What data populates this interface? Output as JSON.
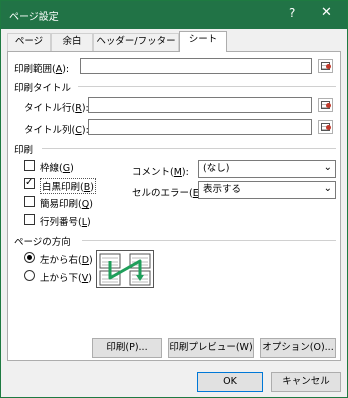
{
  "window": {
    "title": "ページ設定",
    "help_glyph": "?",
    "close_glyph": "✕"
  },
  "tabs": [
    {
      "label": "ページ",
      "active": false
    },
    {
      "label": "余白",
      "active": false
    },
    {
      "label": "ヘッダー/フッター",
      "active": false
    },
    {
      "label": "シート",
      "active": true
    }
  ],
  "print_area": {
    "label": "印刷範囲(",
    "accel": "A",
    "label_end": "):",
    "value": ""
  },
  "print_titles": {
    "heading": "印刷タイトル",
    "rows": {
      "label": "タイトル行(",
      "accel": "R",
      "label_end": "):",
      "value": ""
    },
    "cols": {
      "label": "タイトル列(",
      "accel": "C",
      "label_end": "):",
      "value": ""
    }
  },
  "print": {
    "heading": "印刷",
    "gridlines": {
      "label": "枠線(",
      "accel": "G",
      "label_end": ")",
      "checked": false
    },
    "blackwhite": {
      "label": "白黒印刷(",
      "accel": "B",
      "label_end": ")",
      "checked": true
    },
    "draft": {
      "label": "簡易印刷(",
      "accel": "Q",
      "label_end": ")",
      "checked": false
    },
    "headings": {
      "label": "行列番号(",
      "accel": "L",
      "label_end": ")",
      "checked": false
    },
    "comments": {
      "label": "コメント(",
      "accel": "M",
      "label_end": "):",
      "value": "(なし)"
    },
    "errors": {
      "label": "セルのエラー(",
      "accel": "E",
      "label_end": "):",
      "value": "表示する"
    }
  },
  "page_order": {
    "heading": "ページの方向",
    "down_then_over": {
      "label": "左から右(",
      "accel": "D",
      "label_end": ")",
      "selected": true
    },
    "over_then_down": {
      "label": "上から下(",
      "accel": "V",
      "label_end": ")",
      "selected": false
    }
  },
  "buttons": {
    "print": "印刷(P)...",
    "preview": "印刷プレビュー(W)",
    "options": "オプション(O)...",
    "ok": "OK",
    "cancel": "キャンセル"
  },
  "colors": {
    "titlebar": "#217346",
    "arrow": "#1f9e5a"
  }
}
